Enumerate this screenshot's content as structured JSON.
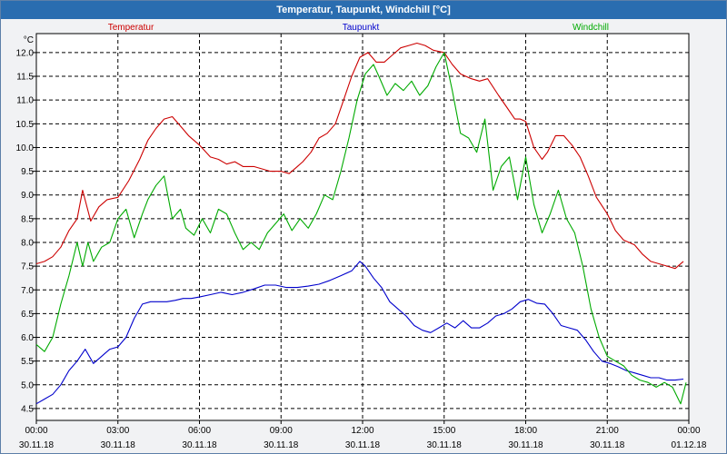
{
  "window": {
    "title": "Temperatur, Taupunkt, Windchill [°C]"
  },
  "colors": {
    "temperature": "#cc0000",
    "dewpoint": "#0000cc",
    "windchill": "#00aa00",
    "grid": "#000000"
  },
  "chart_data": {
    "type": "line",
    "ylabel": "°C",
    "ylim": [
      4.25,
      12.4
    ],
    "yticks": [
      "4.5",
      "5.0",
      "5.5",
      "6.0",
      "6.5",
      "7.0",
      "7.5",
      "8.0",
      "8.5",
      "9.0",
      "9.5",
      "10.0",
      "10.5",
      "11.0",
      "11.5",
      "12.0"
    ],
    "xlim": [
      0,
      24
    ],
    "xticks": [
      {
        "time": "00:00",
        "date": "30.11.18"
      },
      {
        "time": "03:00",
        "date": "30.11.18"
      },
      {
        "time": "06:00",
        "date": "30.11.18"
      },
      {
        "time": "09:00",
        "date": "30.11.18"
      },
      {
        "time": "12:00",
        "date": "30.11.18"
      },
      {
        "time": "15:00",
        "date": "30.11.18"
      },
      {
        "time": "18:00",
        "date": "30.11.18"
      },
      {
        "time": "21:00",
        "date": "30.11.18"
      },
      {
        "time": "00:00",
        "date": "01.12.18"
      }
    ],
    "grid": true,
    "legend_placement": "top",
    "series": [
      {
        "name": "Temperatur",
        "color": "#cc0000",
        "x": [
          0,
          0.3,
          0.6,
          0.9,
          1.2,
          1.5,
          1.7,
          2.0,
          2.3,
          2.6,
          3.0,
          3.4,
          3.8,
          4.1,
          4.4,
          4.7,
          5.0,
          5.3,
          5.6,
          6.0,
          6.4,
          6.7,
          7.0,
          7.3,
          7.6,
          8.0,
          8.3,
          8.6,
          9.0,
          9.3,
          9.6,
          9.8,
          10.1,
          10.4,
          10.7,
          11.0,
          11.3,
          11.6,
          11.9,
          12.2,
          12.5,
          12.8,
          13.1,
          13.4,
          13.7,
          14.0,
          14.3,
          14.6,
          15.0,
          15.3,
          15.6,
          16.0,
          16.3,
          16.6,
          17.0,
          17.3,
          17.6,
          17.8,
          18.0,
          18.3,
          18.6,
          18.8,
          19.1,
          19.4,
          19.7,
          20.0,
          20.3,
          20.6,
          21.0,
          21.3,
          21.6,
          22.0,
          22.3,
          22.6,
          22.9,
          23.2,
          23.5,
          23.8
        ],
        "y": [
          7.55,
          7.6,
          7.7,
          7.9,
          8.25,
          8.5,
          9.1,
          8.45,
          8.75,
          8.9,
          8.95,
          9.3,
          9.75,
          10.15,
          10.4,
          10.6,
          10.65,
          10.45,
          10.25,
          10.05,
          9.8,
          9.75,
          9.65,
          9.7,
          9.6,
          9.6,
          9.55,
          9.5,
          9.5,
          9.45,
          9.6,
          9.7,
          9.9,
          10.2,
          10.3,
          10.5,
          11.0,
          11.5,
          11.9,
          12.0,
          11.8,
          11.8,
          11.95,
          12.1,
          12.15,
          12.2,
          12.15,
          12.05,
          12.0,
          11.75,
          11.55,
          11.45,
          11.4,
          11.45,
          11.1,
          10.85,
          10.6,
          10.6,
          10.55,
          10.0,
          9.75,
          9.9,
          10.25,
          10.25,
          10.05,
          9.8,
          9.4,
          8.95,
          8.6,
          8.25,
          8.05,
          7.95,
          7.75,
          7.6,
          7.55,
          7.5,
          7.45,
          7.6
        ]
      },
      {
        "name": "Taupunkt",
        "color": "#0000cc",
        "x": [
          0,
          0.3,
          0.6,
          0.9,
          1.2,
          1.5,
          1.8,
          2.1,
          2.4,
          2.7,
          3.0,
          3.3,
          3.6,
          3.9,
          4.2,
          4.5,
          4.8,
          5.1,
          5.4,
          5.7,
          6.0,
          6.4,
          6.8,
          7.2,
          7.6,
          8.0,
          8.4,
          8.8,
          9.2,
          9.6,
          10.0,
          10.4,
          10.8,
          11.2,
          11.6,
          11.9,
          12.1,
          12.4,
          12.7,
          13.0,
          13.3,
          13.6,
          13.9,
          14.2,
          14.5,
          14.8,
          15.1,
          15.4,
          15.7,
          16.0,
          16.3,
          16.6,
          16.9,
          17.2,
          17.5,
          17.8,
          18.1,
          18.4,
          18.7,
          19.0,
          19.3,
          19.6,
          19.9,
          20.2,
          20.5,
          20.8,
          21.1,
          21.4,
          21.7,
          22.0,
          22.3,
          22.6,
          22.9,
          23.2,
          23.5,
          23.8
        ],
        "y": [
          4.6,
          4.7,
          4.8,
          5.0,
          5.3,
          5.5,
          5.75,
          5.45,
          5.6,
          5.75,
          5.8,
          6.0,
          6.4,
          6.7,
          6.75,
          6.75,
          6.75,
          6.78,
          6.82,
          6.82,
          6.85,
          6.9,
          6.95,
          6.9,
          6.95,
          7.02,
          7.1,
          7.1,
          7.05,
          7.05,
          7.08,
          7.12,
          7.2,
          7.3,
          7.4,
          7.6,
          7.5,
          7.25,
          7.05,
          6.75,
          6.6,
          6.45,
          6.25,
          6.15,
          6.1,
          6.2,
          6.3,
          6.2,
          6.35,
          6.2,
          6.2,
          6.3,
          6.45,
          6.5,
          6.6,
          6.75,
          6.8,
          6.72,
          6.7,
          6.5,
          6.25,
          6.2,
          6.15,
          5.95,
          5.7,
          5.5,
          5.45,
          5.38,
          5.3,
          5.25,
          5.2,
          5.15,
          5.15,
          5.1,
          5.1,
          5.12
        ]
      },
      {
        "name": "Windchill",
        "color": "#00aa00",
        "x": [
          0,
          0.3,
          0.6,
          0.9,
          1.2,
          1.5,
          1.7,
          1.9,
          2.1,
          2.4,
          2.7,
          3.0,
          3.3,
          3.6,
          3.9,
          4.1,
          4.4,
          4.7,
          5.0,
          5.3,
          5.5,
          5.8,
          6.1,
          6.4,
          6.7,
          7.0,
          7.3,
          7.6,
          7.9,
          8.2,
          8.5,
          8.8,
          9.1,
          9.4,
          9.7,
          10.0,
          10.3,
          10.6,
          10.9,
          11.2,
          11.5,
          11.8,
          12.1,
          12.4,
          12.6,
          12.9,
          13.2,
          13.5,
          13.8,
          14.1,
          14.4,
          14.7,
          15.0,
          15.3,
          15.6,
          15.9,
          16.2,
          16.5,
          16.8,
          17.1,
          17.4,
          17.7,
          18.0,
          18.3,
          18.6,
          18.9,
          19.2,
          19.5,
          19.8,
          20.1,
          20.4,
          20.7,
          21.0,
          21.3,
          21.6,
          21.9,
          22.2,
          22.5,
          22.8,
          23.1,
          23.4,
          23.7,
          23.9
        ],
        "y": [
          5.85,
          5.7,
          6.0,
          6.7,
          7.3,
          8.0,
          7.5,
          8.0,
          7.6,
          7.9,
          8.0,
          8.5,
          8.7,
          8.1,
          8.6,
          8.9,
          9.2,
          9.4,
          8.5,
          8.7,
          8.3,
          8.15,
          8.5,
          8.2,
          8.7,
          8.6,
          8.2,
          7.85,
          8.0,
          7.85,
          8.2,
          8.4,
          8.6,
          8.25,
          8.5,
          8.3,
          8.6,
          9.0,
          8.9,
          9.5,
          10.2,
          11.0,
          11.55,
          11.75,
          11.5,
          11.1,
          11.35,
          11.2,
          11.4,
          11.1,
          11.3,
          11.7,
          12.0,
          11.2,
          10.3,
          10.2,
          9.9,
          10.6,
          9.1,
          9.6,
          9.8,
          8.9,
          9.8,
          8.8,
          8.2,
          8.6,
          9.1,
          8.5,
          8.2,
          7.5,
          6.6,
          6.0,
          5.6,
          5.5,
          5.4,
          5.2,
          5.1,
          5.05,
          4.95,
          5.05,
          4.95,
          4.6,
          5.05
        ]
      }
    ]
  }
}
